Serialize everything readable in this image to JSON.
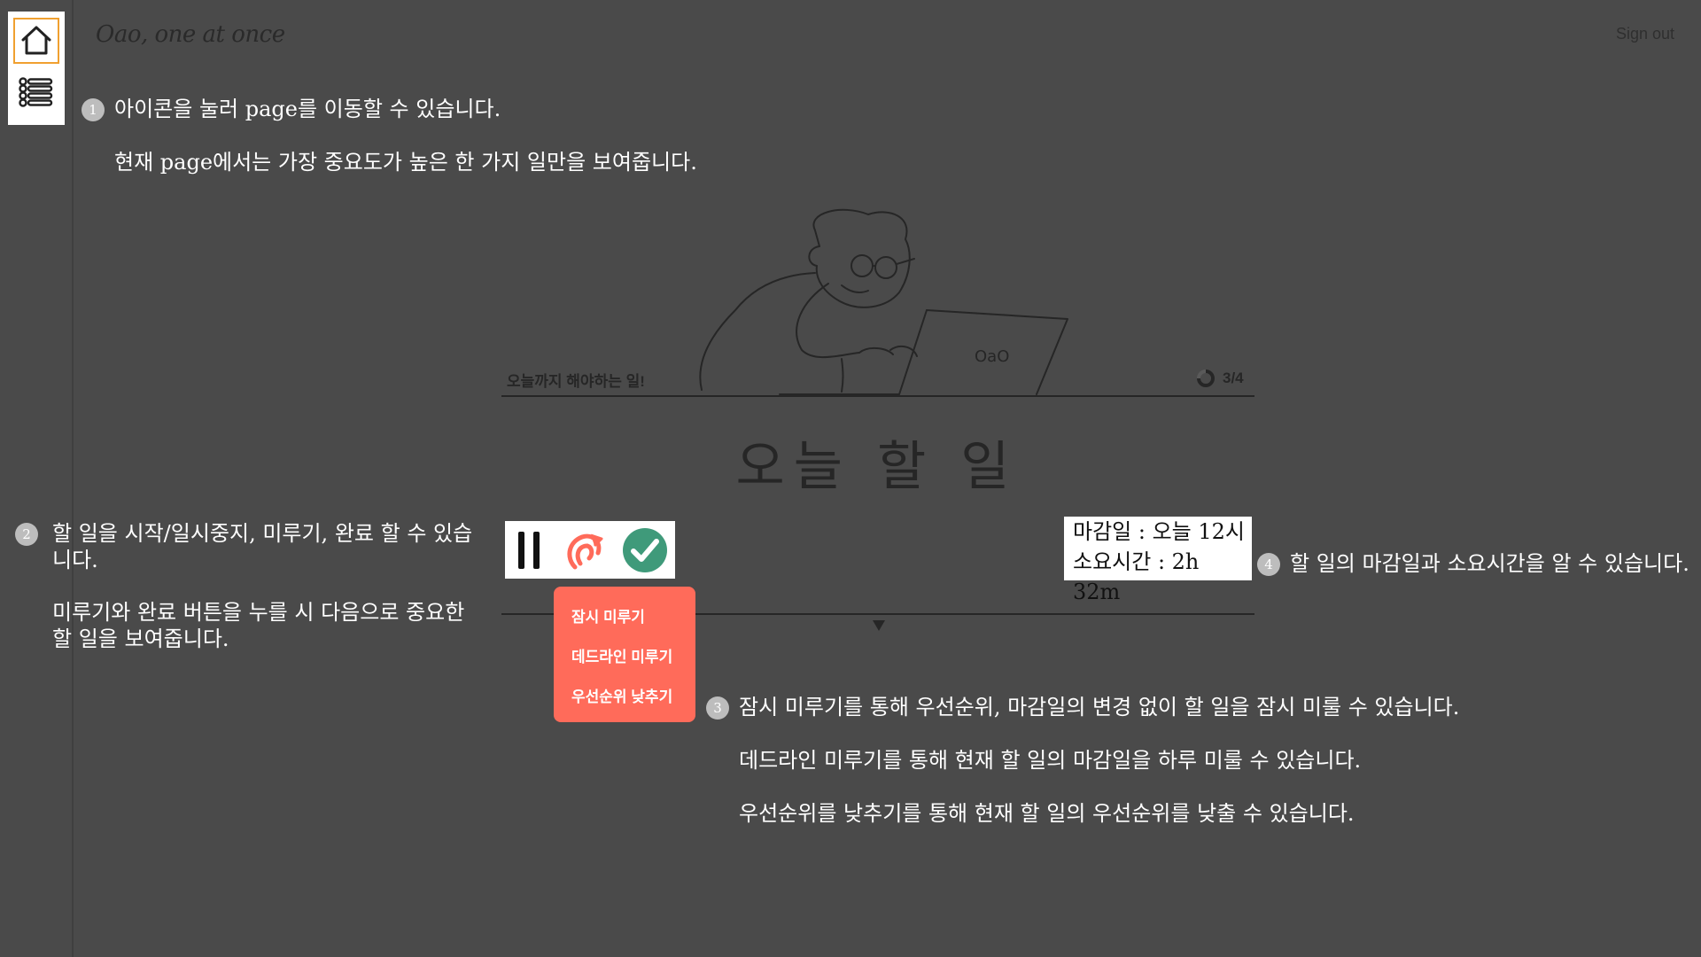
{
  "app": {
    "title": "Oao, one at once",
    "sign_out": "Sign out"
  },
  "sidebar": {
    "items": [
      {
        "name": "home",
        "icon": "home-icon",
        "active": true
      },
      {
        "name": "list",
        "icon": "list-icon",
        "active": false
      }
    ],
    "active_color": "#f0a030"
  },
  "guide": {
    "step1": {
      "num": "1",
      "line1": "아이콘을 눌러 page를 이동할 수 있습니다.",
      "line2": "현재 page에서는 가장 중요도가 높은 한 가지 일만을 보여줍니다."
    },
    "step2": {
      "num": "2",
      "para1": "할 일을 시작/일시중지, 미루기, 완료 할 수 있습니다.",
      "para2": "미루기와 완료 버튼을 누를 시 다음으로 중요한 할 일을 보여줍니다."
    },
    "step3": {
      "num": "3",
      "line1": "잠시 미루기를 통해 우선순위, 마감일의 변경 없이 할 일을 잠시 미룰 수 있습니다.",
      "line2": "데드라인 미루기를 통해 현재 할 일의 마감일을 하루 미룰 수 있습니다.",
      "line3": "우선순위를 낮추기를 통해 현재 할 일의 우선순위를 낮출 수 있습니다."
    },
    "step4": {
      "num": "4",
      "text": "할 일의 마감일과 소요시간을 알 수 있습니다."
    }
  },
  "task": {
    "section_label": "오늘까지 해야하는 일!",
    "progress": "3/4",
    "progress_fraction": 0.75,
    "title": "오늘 할 일",
    "deadline": "마감일 : 오늘 12시",
    "duration": "소요시간 : 2h 32m",
    "laptop_text": "OaO"
  },
  "controls": {
    "pause_icon": "pause-icon",
    "postpone_icon": "postpone-icon",
    "complete_icon": "check-circle-icon",
    "postpone_color": "#ff6b5a",
    "complete_color": "#3f9a7a"
  },
  "postpone_menu": {
    "items": [
      "잠시 미루기",
      "데드라인 미루기",
      "우선순위 낮추기"
    ],
    "bg_color": "#ff6b5a"
  }
}
